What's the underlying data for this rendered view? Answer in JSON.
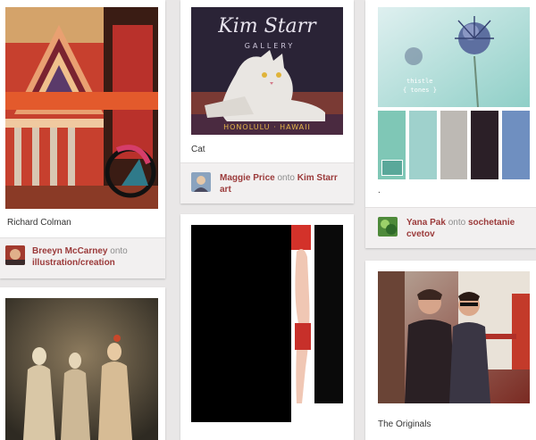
{
  "pins": [
    {
      "id": "richard-colman",
      "description": "Richard Colman",
      "pinner": "Breeyn McCarney",
      "connector": "onto",
      "board": "illustration/creation"
    },
    {
      "id": "cat",
      "image_text": {
        "logo_script": "Kim Starr",
        "logo_sub": "GALLERY",
        "bottom_text": "HONOLULU · HAWAII"
      },
      "description": "Cat",
      "pinner": "Maggie Price",
      "connector": "onto",
      "board": "Kim Starr art"
    },
    {
      "id": "thistle",
      "image_text": {
        "caption_line1": "thistle",
        "caption_line2": "{ tones }"
      },
      "palette": [
        "#7fc7b6",
        "#9fd1cc",
        "#bdb9b4",
        "#2b1f27",
        "#6f8fc0"
      ],
      "description": ".",
      "pinner": "Yana Pak",
      "connector": "onto",
      "board": "sochetanie cvetov"
    },
    {
      "id": "ghost-figures"
    },
    {
      "id": "black-door-figure"
    },
    {
      "id": "the-originals",
      "description": "The Originals"
    }
  ]
}
